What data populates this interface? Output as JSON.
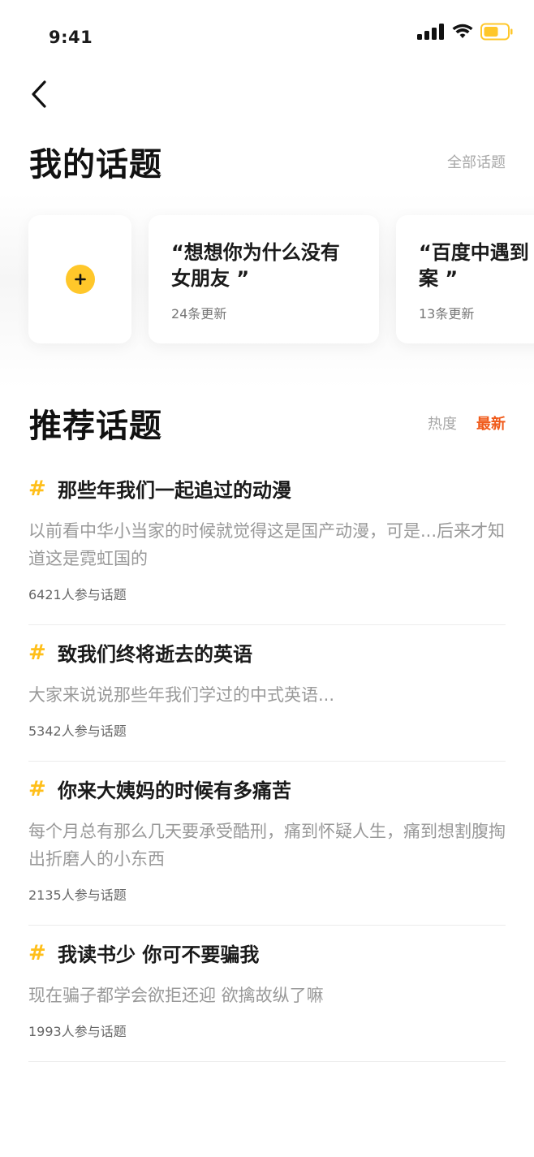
{
  "status_bar": {
    "time": "9:41"
  },
  "my_topics": {
    "title": "我的话题",
    "all_link": "全部话题",
    "cards": [
      {
        "title": "“想想你为什么没有\n女朋友 ”",
        "updates": "24条更新"
      },
      {
        "title": "“百度中遇到\n案 ”",
        "updates": "13条更新"
      }
    ]
  },
  "recommended": {
    "title": "推荐话题",
    "sort_tabs": [
      {
        "label": "热度",
        "active": false
      },
      {
        "label": "最新",
        "active": true
      }
    ],
    "topics": [
      {
        "title": "那些年我们一起追过的动漫",
        "desc": "以前看中华小当家的时候就觉得这是国产动漫，可是...后来才知道这是霓虹国的",
        "count": "6421人参与话题"
      },
      {
        "title": "致我们终将逝去的英语",
        "desc": "大家来说说那些年我们学过的中式英语...",
        "count": "5342人参与话题"
      },
      {
        "title": "你来大姨妈的时候有多痛苦",
        "desc": "每个月总有那么几天要承受酷刑，痛到怀疑人生，痛到想割腹掏出折磨人的小东西",
        "count": "2135人参与话题"
      },
      {
        "title": "我读书少 你可不要骗我",
        "desc": "现在骗子都学会欲拒还迎 欲擒故纵了嘛",
        "count": "1993人参与话题"
      }
    ]
  },
  "icons": {
    "signal": "cellular-signal-icon",
    "wifi": "wifi-icon",
    "battery": "battery-icon",
    "back": "back-chevron-icon",
    "add": "plus-icon",
    "hash": "hashtag-icon"
  },
  "colors": {
    "accent": "#ffc72a",
    "active_tab": "#f05a1a",
    "hash": "#ffbf1a"
  }
}
